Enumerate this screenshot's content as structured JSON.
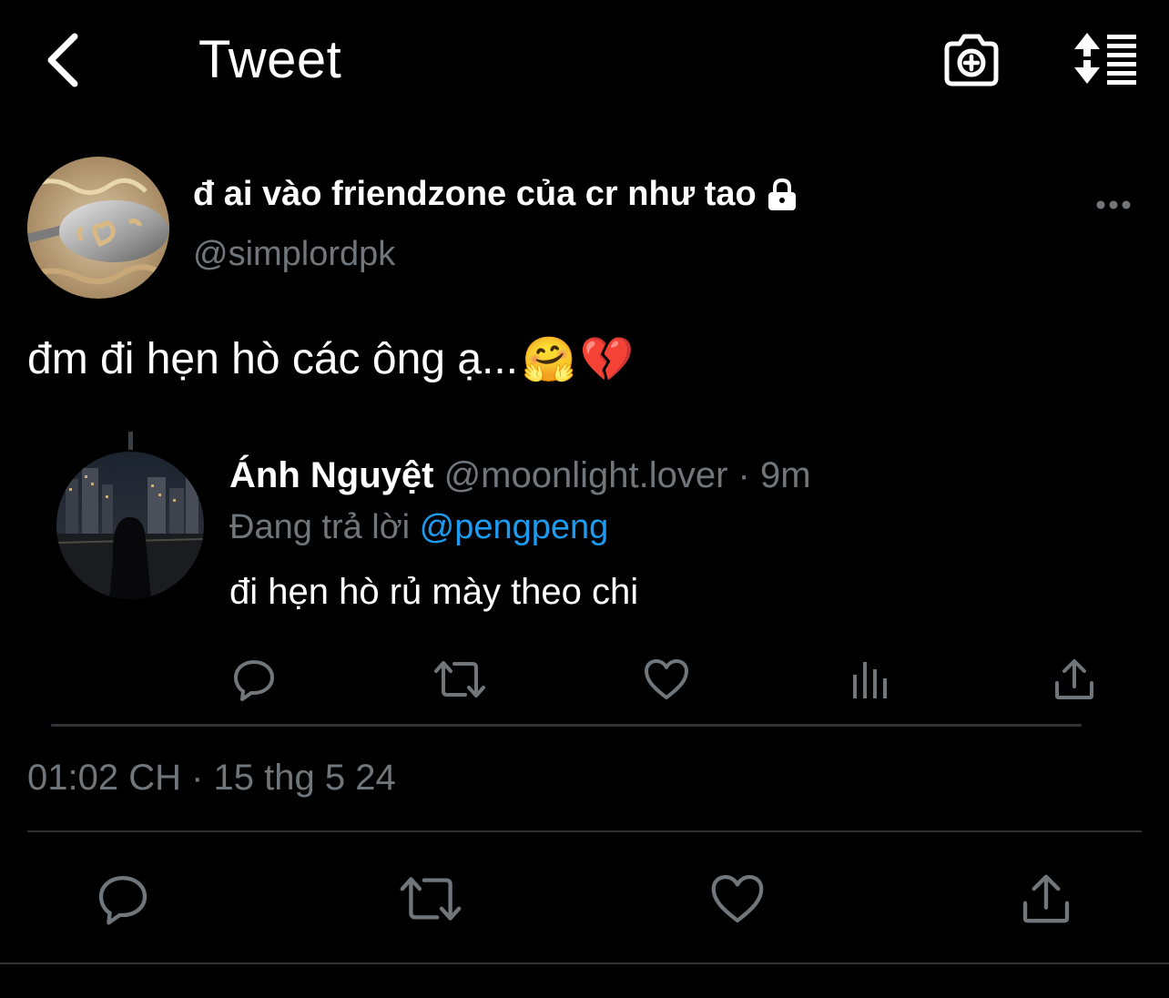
{
  "header": {
    "title": "Tweet",
    "back_icon": "chevron-left-icon",
    "camera_icon": "camera-plus-icon",
    "sort_icon": "sort-list-icon"
  },
  "tweet": {
    "author_name": "đ ai vào friendzone của cr như tao",
    "lock_icon": "lock-icon",
    "handle": "@simplordpk",
    "more_icon": "ellipsis-icon",
    "text": "đm đi hẹn hò các ông ạ...",
    "emoji_1": "🤗",
    "emoji_2": "💔",
    "timestamp": "01:02 CH · 15 thg 5 24"
  },
  "quoted_reply": {
    "name": "Ánh Nguyệt",
    "meta": "@moonlight.lover · 9m",
    "replying_prefix": "Đang trả lời",
    "replying_to": "@pengpeng",
    "text": "đi hẹn hò rủ mày theo chi",
    "actions": [
      "reply-icon",
      "retweet-icon",
      "like-icon",
      "stats-icon",
      "share-icon"
    ]
  },
  "main_actions": [
    "reply-icon",
    "retweet-icon",
    "like-icon",
    "share-icon"
  ],
  "colors": {
    "background": "#000000",
    "text_primary": "#ffffff",
    "text_secondary": "#71767b",
    "accent": "#1d9bf0",
    "divider": "#2f3336"
  }
}
